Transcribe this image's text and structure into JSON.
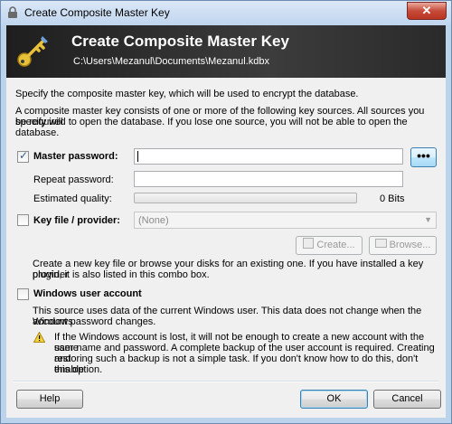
{
  "window": {
    "title": "Create Composite Master Key",
    "close_glyph": "✕"
  },
  "banner": {
    "title": "Create Composite Master Key",
    "subtitle": "C:\\Users\\Mezanul\\Documents\\Mezanul.kdbx"
  },
  "intro": {
    "line1": "Specify the composite master key, which will be used to encrypt the database.",
    "line2a": "A composite master key consists of one or more of the following key sources. All sources you specify will",
    "line2b": "be required to open the database.  If you lose one source, you will not be able to open the database."
  },
  "master_password": {
    "checked": true,
    "label": "Master password:",
    "value": "",
    "reveal_label": "•••",
    "repeat_label": "Repeat password:",
    "repeat_value": "",
    "quality_label": "Estimated quality:",
    "quality_value": "0 Bits",
    "quality_fraction": 0
  },
  "key_file": {
    "checked": false,
    "label": "Key file / provider:",
    "selected": "(None)",
    "create_label": "Create...",
    "browse_label": "Browse...",
    "help_a": "Create a new key file or browse your disks for an existing one. If you have installed a key provider",
    "help_b": "plugin, it is also listed in this combo box."
  },
  "windows_account": {
    "checked": false,
    "label": "Windows user account",
    "desc_a": "This source uses data of the current Windows user. This data does not change when the Windows",
    "desc_b": "account password changes.",
    "warn_a": "If the Windows account is lost, it will not be enough to create a new account with the same",
    "warn_b": "user name and password. A complete backup of the user account is required. Creating and",
    "warn_c": "restoring such a backup is not a simple task. If you don't know how to do this, don't enable",
    "warn_d": "this option."
  },
  "buttons": {
    "help": "Help",
    "ok": "OK",
    "cancel": "Cancel"
  }
}
